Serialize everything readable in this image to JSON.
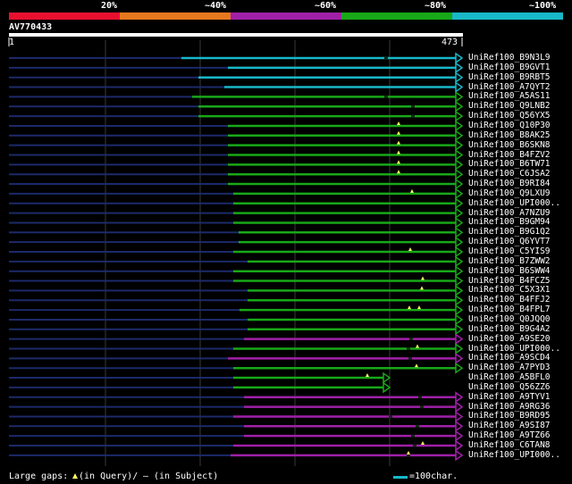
{
  "scale": {
    "labels": [
      "20%",
      "~40%",
      "~60%",
      "~80%",
      "~100%"
    ],
    "colors": [
      "#e8102e",
      "#e8781e",
      "#a020a8",
      "#18a818",
      "#18b8c8"
    ]
  },
  "query": {
    "id": "AV770433",
    "start": "1",
    "end": "473"
  },
  "hits": [
    {
      "name": "UniRef100_B9N3L9",
      "color": "#18b8c8"
    },
    {
      "name": "UniRef100_B9GVT1",
      "color": "#18b8c8"
    },
    {
      "name": "UniRef100_B9RBT5",
      "color": "#18b8c8"
    },
    {
      "name": "UniRef100_A7QYT2",
      "color": "#18b8c8"
    },
    {
      "name": "UniRef100_A5AS11",
      "color": "#18a818"
    },
    {
      "name": "UniRef100_Q9LNB2",
      "color": "#18a818"
    },
    {
      "name": "UniRef100_Q56YX5",
      "color": "#18a818"
    },
    {
      "name": "UniRef100_Q10P30",
      "color": "#18a818"
    },
    {
      "name": "UniRef100_B8AK25",
      "color": "#18a818"
    },
    {
      "name": "UniRef100_B6SKN8",
      "color": "#18a818"
    },
    {
      "name": "UniRef100_B4FZV2",
      "color": "#18a818"
    },
    {
      "name": "UniRef100_B6TW71",
      "color": "#18a818"
    },
    {
      "name": "UniRef100_C6JSA2",
      "color": "#18a818"
    },
    {
      "name": "UniRef100_B9RI84",
      "color": "#18a818"
    },
    {
      "name": "UniRef100_Q9LXU9",
      "color": "#18a818"
    },
    {
      "name": "UniRef100_UPI000..",
      "color": "#18a818"
    },
    {
      "name": "UniRef100_A7NZU9",
      "color": "#18a818"
    },
    {
      "name": "UniRef100_B9GM94",
      "color": "#18a818"
    },
    {
      "name": "UniRef100_B9G1Q2",
      "color": "#18a818"
    },
    {
      "name": "UniRef100_Q6YVT7",
      "color": "#18a818"
    },
    {
      "name": "UniRef100_C5YIS9",
      "color": "#18a818"
    },
    {
      "name": "UniRef100_B7ZWW2",
      "color": "#18a818"
    },
    {
      "name": "UniRef100_B6SWW4",
      "color": "#18a818"
    },
    {
      "name": "UniRef100_B4FCZ5",
      "color": "#18a818"
    },
    {
      "name": "UniRef100_C5X3X1",
      "color": "#18a818"
    },
    {
      "name": "UniRef100_B4FFJ2",
      "color": "#18a818"
    },
    {
      "name": "UniRef100_B4FPL7",
      "color": "#18a818"
    },
    {
      "name": "UniRef100_Q0JQQ0",
      "color": "#18a818"
    },
    {
      "name": "UniRef100_B9G4A2",
      "color": "#18a818"
    },
    {
      "name": "UniRef100_A9SE20",
      "color": "#a020a8"
    },
    {
      "name": "UniRef100_UPI000..",
      "color": "#18a818"
    },
    {
      "name": "UniRef100_A9SCD4",
      "color": "#a020a8"
    },
    {
      "name": "UniRef100_A7PYD3",
      "color": "#18a818"
    },
    {
      "name": "UniRef100_A5BFL0",
      "color": "#18a818"
    },
    {
      "name": "UniRef100_Q56ZZ6",
      "color": "#18a818"
    },
    {
      "name": "UniRef100_A9TYV1",
      "color": "#a020a8"
    },
    {
      "name": "UniRef100_A9RG36",
      "color": "#a020a8"
    },
    {
      "name": "UniRef100_B9RD95",
      "color": "#a020a8"
    },
    {
      "name": "UniRef100_A9SI87",
      "color": "#a020a8"
    },
    {
      "name": "UniRef100_A9TZ66",
      "color": "#a020a8"
    },
    {
      "name": "UniRef100_C6TAN8",
      "color": "#a020a8"
    },
    {
      "name": "UniRef100_UPI000..",
      "color": "#a020a8"
    }
  ],
  "footer": {
    "gaps_label": "Large gaps:",
    "in_query": "(in Query)/",
    "dash": "—",
    "in_subject": "(in Subject)",
    "scale_label": "=100char.",
    "scale_color": "#18b8c8"
  }
}
